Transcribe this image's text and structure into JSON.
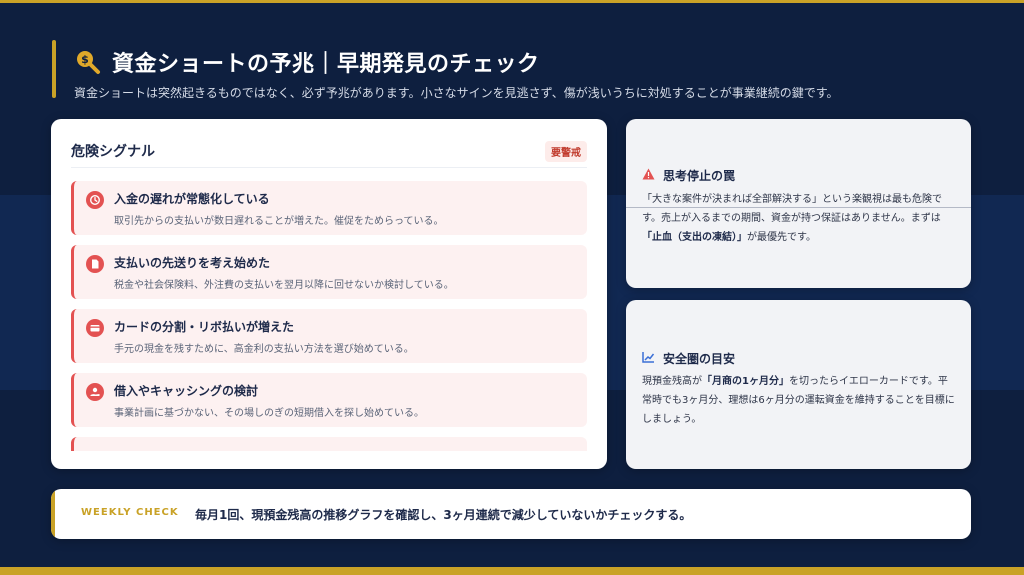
{
  "header": {
    "title": "資金ショートの予兆｜早期発見のチェック",
    "subtitle": "資金ショートは突然起きるものではなく、必ず予兆があります。小さなサインを見逃さず、傷が浅いうちに対処することが事業継続の鍵です。",
    "icon": "search-dollar-icon"
  },
  "signals": {
    "title": "危険シグナル",
    "badge": "要警戒",
    "items": [
      {
        "title": "入金の遅れが常態化している",
        "desc": "取引先からの支払いが数日遅れることが増えた。催促をためらっている。",
        "icon": "clock-history-icon"
      },
      {
        "title": "支払いの先送りを考え始めた",
        "desc": "税金や社会保険料、外注費の支払いを翌月以降に回せないか検討している。",
        "icon": "document-icon"
      },
      {
        "title": "カードの分割・リボ払いが増えた",
        "desc": "手元の現金を残すために、高金利の支払い方法を選び始めている。",
        "icon": "credit-card-icon"
      },
      {
        "title": "借入やキャッシングの検討",
        "desc": "事業計画に基づかない、その場しのぎの短期借入を探し始めている。",
        "icon": "hand-money-icon"
      }
    ]
  },
  "trap": {
    "title": "思考停止の罠",
    "icon": "warning-triangle-icon",
    "body_1": "「大きな案件が決まれば全部解決する」という楽観視は最も危険です。売上が入るまでの期間、資金が持つ保証はありません。まずは",
    "body_bold": "「止血（支出の凍結）」",
    "body_2": "が最優先です。"
  },
  "safe": {
    "title": "安全圏の目安",
    "icon": "line-chart-icon",
    "body_1": "現預金残高が",
    "body_bold": "「月商の1ヶ月分」",
    "body_2": "を切ったらイエローカードです。平常時でも3ヶ月分、理想は6ヶ月分の運転資金を維持することを目標にしましょう。"
  },
  "weekly": {
    "label": "WEEKLY CHECK",
    "text": "毎月1回、現預金残高の推移グラフを確認し、3ヶ月連続で減少していないかチェックする。"
  },
  "colors": {
    "background": "#0e1f3f",
    "band": "#122a56",
    "accent_gold": "#c9a227",
    "danger_red": "#e35252",
    "navy_text": "#1e2a4a"
  }
}
